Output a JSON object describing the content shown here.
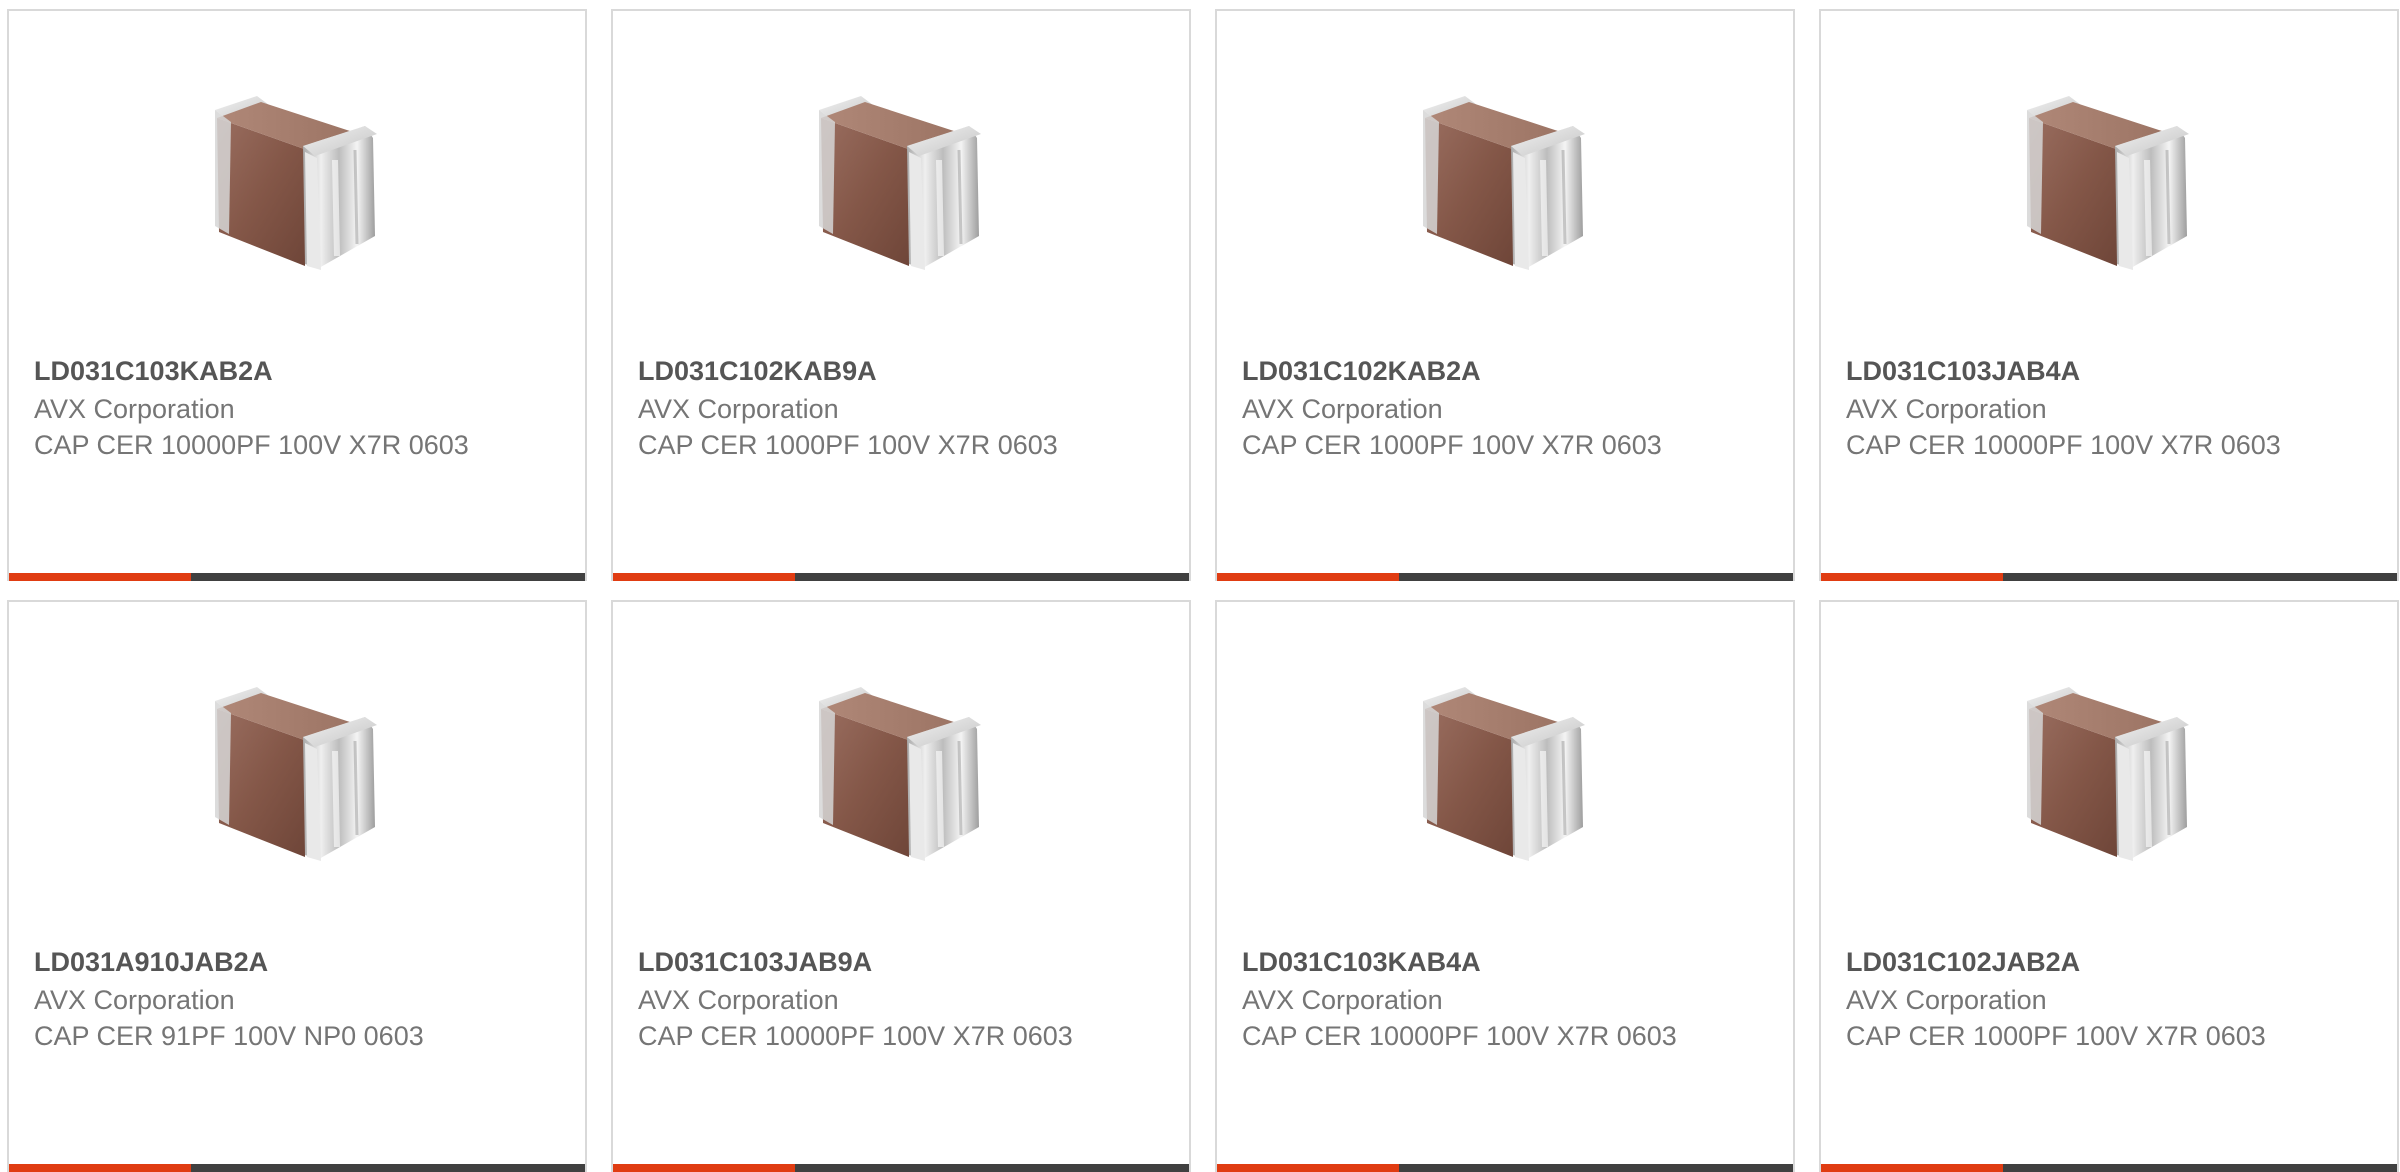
{
  "colors": {
    "accent": "#e03c12",
    "bar_dark": "#404040",
    "text_secondary": "#757575",
    "text_primary": "#555555",
    "card_border": "#d9d9d9"
  },
  "products": [
    {
      "part_number": "LD031C103KAB2A",
      "manufacturer": "AVX Corporation",
      "description": "CAP CER 10000PF 100V X7R 0603",
      "image_icon": "capacitor-chip-icon"
    },
    {
      "part_number": "LD031C102KAB9A",
      "manufacturer": "AVX Corporation",
      "description": "CAP CER 1000PF 100V X7R 0603",
      "image_icon": "capacitor-chip-icon"
    },
    {
      "part_number": "LD031C102KAB2A",
      "manufacturer": "AVX Corporation",
      "description": "CAP CER 1000PF 100V X7R 0603",
      "image_icon": "capacitor-chip-icon"
    },
    {
      "part_number": "LD031C103JAB4A",
      "manufacturer": "AVX Corporation",
      "description": "CAP CER 10000PF 100V X7R 0603",
      "image_icon": "capacitor-chip-icon"
    },
    {
      "part_number": "LD031A910JAB2A",
      "manufacturer": "AVX Corporation",
      "description": "CAP CER 91PF 100V NP0 0603",
      "image_icon": "capacitor-chip-icon"
    },
    {
      "part_number": "LD031C103JAB9A",
      "manufacturer": "AVX Corporation",
      "description": "CAP CER 10000PF 100V X7R 0603",
      "image_icon": "capacitor-chip-icon"
    },
    {
      "part_number": "LD031C103KAB4A",
      "manufacturer": "AVX Corporation",
      "description": "CAP CER 10000PF 100V X7R 0603",
      "image_icon": "capacitor-chip-icon"
    },
    {
      "part_number": "LD031C102JAB2A",
      "manufacturer": "AVX Corporation",
      "description": "CAP CER 1000PF 100V X7R 0603",
      "image_icon": "capacitor-chip-icon"
    }
  ]
}
